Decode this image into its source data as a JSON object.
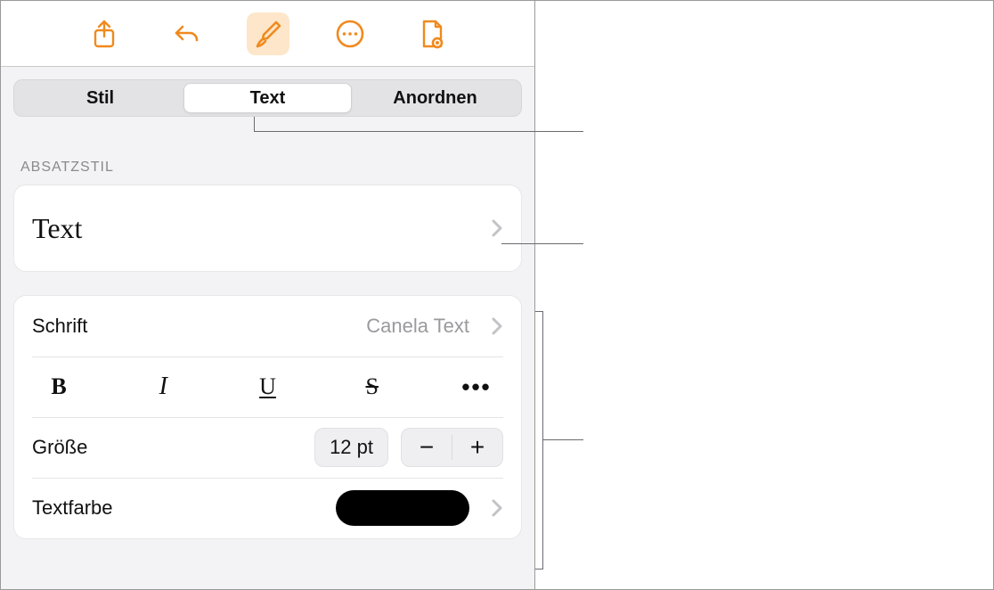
{
  "toolbar": {
    "share_icon": "share-icon",
    "undo_icon": "undo-icon",
    "format_icon": "paintbrush-icon",
    "more_icon": "more-icon",
    "doc_icon": "document-view-icon"
  },
  "tabs": {
    "style": "Stil",
    "text": "Text",
    "arrange": "Anordnen",
    "selected": "text"
  },
  "sections": {
    "paragraph_style_label": "ABSATZSTIL"
  },
  "paragraph_style": {
    "name": "Text"
  },
  "font_row": {
    "label": "Schrift",
    "value": "Canela Text"
  },
  "style_buttons": {
    "bold": "B",
    "italic": "I",
    "underline": "U",
    "strike": "S",
    "more": "•••"
  },
  "size_row": {
    "label": "Größe",
    "value": "12 pt",
    "minus": "−",
    "plus": "+"
  },
  "color_row": {
    "label": "Textfarbe",
    "color": "#000000"
  }
}
